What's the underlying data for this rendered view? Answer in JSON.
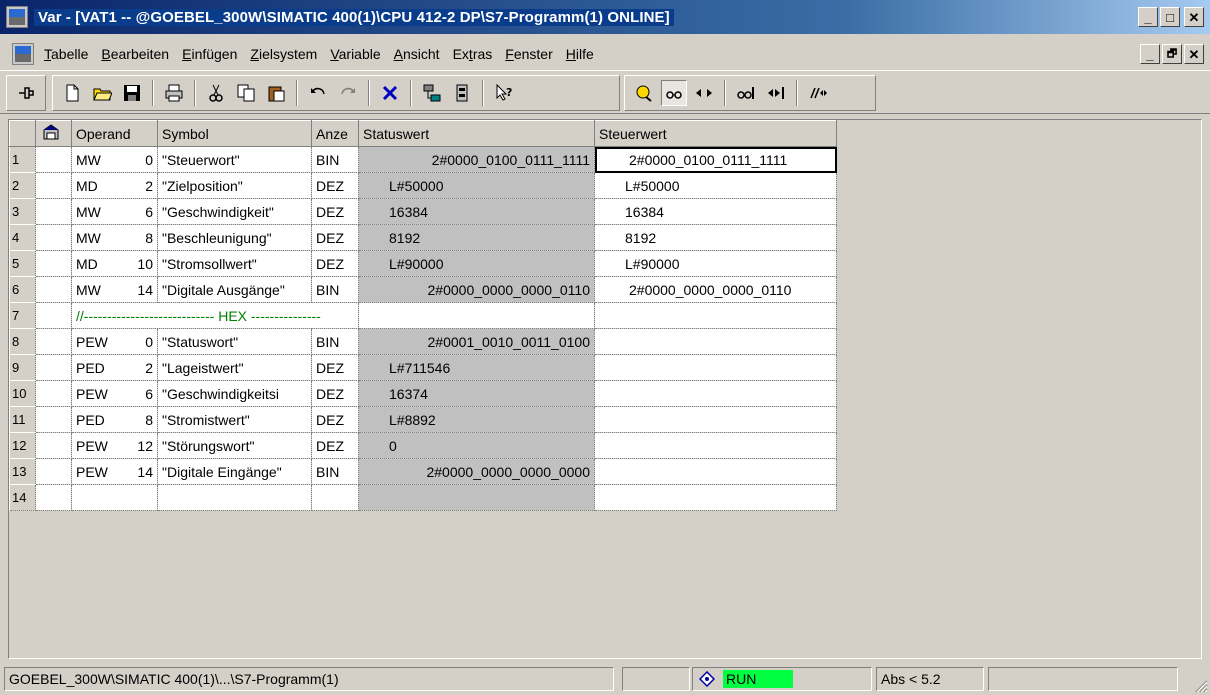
{
  "window": {
    "title": "Var - [VAT1 -- @GOEBEL_300W\\SIMATIC 400(1)\\CPU 412-2 DP\\S7-Programm(1)  ONLINE]",
    "controls": {
      "minimize": "_",
      "maximize": "□",
      "close": "✕",
      "restore": "🗗"
    }
  },
  "menu": {
    "items": [
      {
        "label": "Tabelle",
        "accel_index": 0
      },
      {
        "label": "Bearbeiten",
        "accel_index": 0
      },
      {
        "label": "Einfügen",
        "accel_index": 0
      },
      {
        "label": "Zielsystem",
        "accel_index": 0
      },
      {
        "label": "Variable",
        "accel_index": 0
      },
      {
        "label": "Ansicht",
        "accel_index": 0
      },
      {
        "label": "Extras",
        "accel_index": 2
      },
      {
        "label": "Fenster",
        "accel_index": 0
      },
      {
        "label": "Hilfe",
        "accel_index": 0
      }
    ]
  },
  "table": {
    "headers": {
      "operand": "Operand",
      "symbol": "Symbol",
      "format": "Anze",
      "status": "Statuswert",
      "control": "Steuerwert"
    },
    "rows": [
      {
        "n": "1",
        "op": "MW",
        "addr": "0",
        "symbol": "\"Steuerwort\"",
        "format": "BIN",
        "status": "2#0000_0100_0111_1111",
        "control": "2#0000_0100_0111_1111"
      },
      {
        "n": "2",
        "op": "MD",
        "addr": "2",
        "symbol": "\"Zielposition\"",
        "format": "DEZ",
        "status": "L#50000",
        "control": "L#50000"
      },
      {
        "n": "3",
        "op": "MW",
        "addr": "6",
        "symbol": "\"Geschwindigkeit\"",
        "format": "DEZ",
        "status": "16384",
        "control": "16384"
      },
      {
        "n": "4",
        "op": "MW",
        "addr": "8",
        "symbol": "\"Beschleunigung\"",
        "format": "DEZ",
        "status": "8192",
        "control": "8192"
      },
      {
        "n": "5",
        "op": "MD",
        "addr": "10",
        "symbol": "\"Stromsollwert\"",
        "format": "DEZ",
        "status": "L#90000",
        "control": "L#90000"
      },
      {
        "n": "6",
        "op": "MW",
        "addr": "14",
        "symbol": "\"Digitale Ausgänge\"",
        "format": "BIN",
        "status": "2#0000_0000_0000_0110",
        "control": "2#0000_0000_0000_0110"
      },
      {
        "n": "7",
        "comment": "//---------------------------- HEX ---------------"
      },
      {
        "n": "8",
        "op": "PEW",
        "addr": "0",
        "symbol": "\"Statuswort\"",
        "format": "BIN",
        "status": "2#0001_0010_0011_0100",
        "control": ""
      },
      {
        "n": "9",
        "op": "PED",
        "addr": "2",
        "symbol": "\"Lageistwert\"",
        "format": "DEZ",
        "status": "L#711546",
        "control": ""
      },
      {
        "n": "10",
        "op": "PEW",
        "addr": "6",
        "symbol": "\"Geschwindigkeitsi",
        "format": "DEZ",
        "status": "16374",
        "control": ""
      },
      {
        "n": "11",
        "op": "PED",
        "addr": "8",
        "symbol": "\"Stromistwert\"",
        "format": "DEZ",
        "status": "L#8892",
        "control": ""
      },
      {
        "n": "12",
        "op": "PEW",
        "addr": "12",
        "symbol": "\"Störungswort\"",
        "format": "DEZ",
        "status": "0",
        "control": ""
      },
      {
        "n": "13",
        "op": "PEW",
        "addr": "14",
        "symbol": "\"Digitale Eingänge\"",
        "format": "BIN",
        "status": "2#0000_0000_0000_0000",
        "control": ""
      },
      {
        "n": "14",
        "op": "",
        "addr": "",
        "symbol": "",
        "format": "",
        "status": "",
        "control": ""
      }
    ]
  },
  "status": {
    "path": "GOEBEL_300W\\SIMATIC 400(1)\\...\\S7-Programm(1)",
    "run": "RUN",
    "mode": "Abs < 5.2",
    "run_color": "#00ff40"
  },
  "colors": {
    "title_start": "#0a246a",
    "comment": "#008000",
    "status_column": "#c0c0c0"
  }
}
